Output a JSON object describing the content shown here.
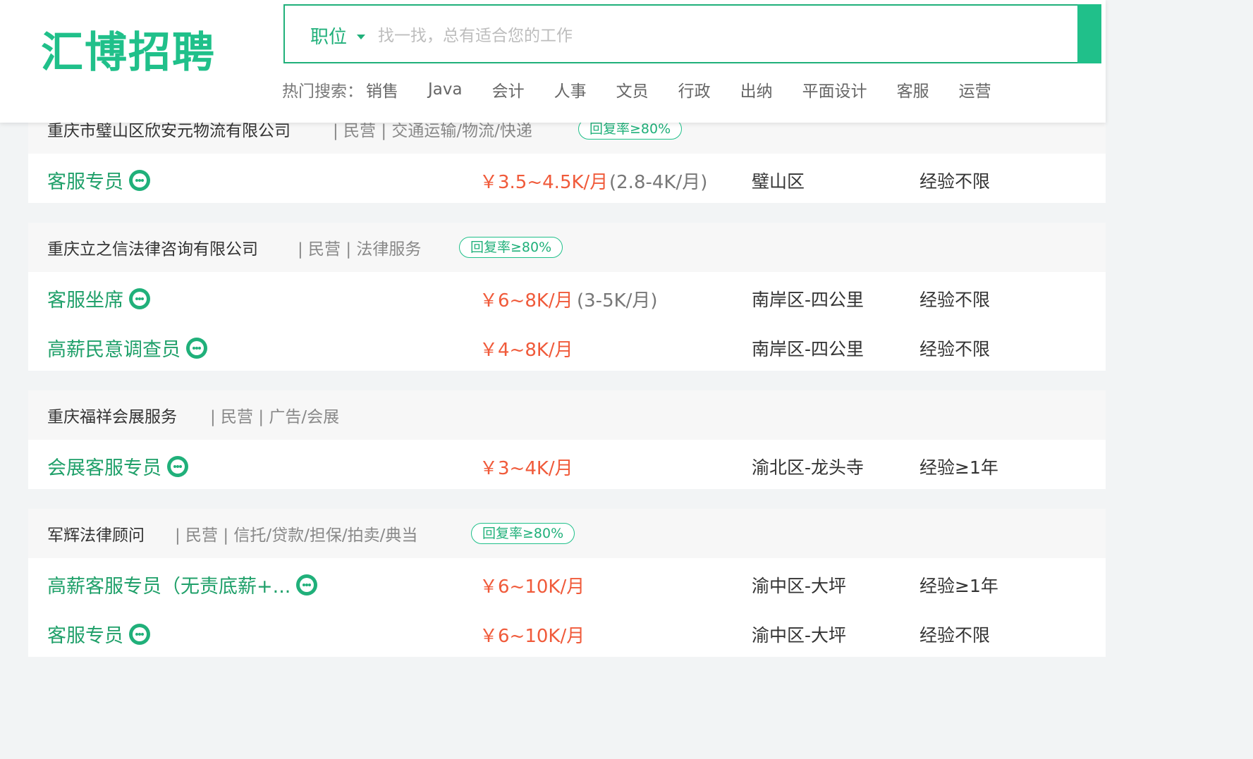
{
  "header": {
    "logo": "汇博招聘",
    "search": {
      "type_label": "职位",
      "placeholder": "找一找，总有适合您的工作"
    },
    "hot_label": "热门搜索：",
    "hot_items": [
      "销售",
      "Java",
      "会计",
      "人事",
      "文员",
      "行政",
      "出纳",
      "平面设计",
      "客服",
      "运营"
    ]
  },
  "listings": [
    {
      "company": "重庆市璧山区欣安元物流有限公司",
      "meta": "| 民营 | 交通运输/物流/快递",
      "reply_badge": "回复率≥80%",
      "jobs": [
        {
          "title": "客服专员",
          "salary": "￥3.5~4.5K/月",
          "salary_sub": "(2.8-4K/月)",
          "location": "璧山区",
          "experience": "经验不限"
        }
      ]
    },
    {
      "company": "重庆立之信法律咨询有限公司",
      "meta": "| 民营 | 法律服务",
      "reply_badge": "回复率≥80%",
      "jobs": [
        {
          "title": "客服坐席",
          "salary": "￥6~8K/月",
          "salary_sub": "(3-5K/月)",
          "location": "南岸区-四公里",
          "experience": "经验不限"
        },
        {
          "title": "高薪民意调查员",
          "salary": "￥4~8K/月",
          "location": "南岸区-四公里",
          "experience": "经验不限"
        }
      ]
    },
    {
      "company": "重庆福祥会展服务",
      "meta": "| 民营 | 广告/会展",
      "jobs": [
        {
          "title": "会展客服专员",
          "salary": "￥3~4K/月",
          "location": "渝北区-龙头寺",
          "experience": "经验≥1年"
        }
      ]
    },
    {
      "company": "军辉法律顾问",
      "meta": "| 民营 | 信托/贷款/担保/拍卖/典当",
      "reply_badge": "回复率≥80%",
      "jobs": [
        {
          "title": "高薪客服专员（无责底薪+...",
          "salary": "￥6~10K/月",
          "location": "渝中区-大坪",
          "experience": "经验≥1年"
        },
        {
          "title": "客服专员",
          "salary": "￥6~10K/月",
          "location": "渝中区-大坪",
          "experience": "经验不限"
        }
      ]
    }
  ]
}
